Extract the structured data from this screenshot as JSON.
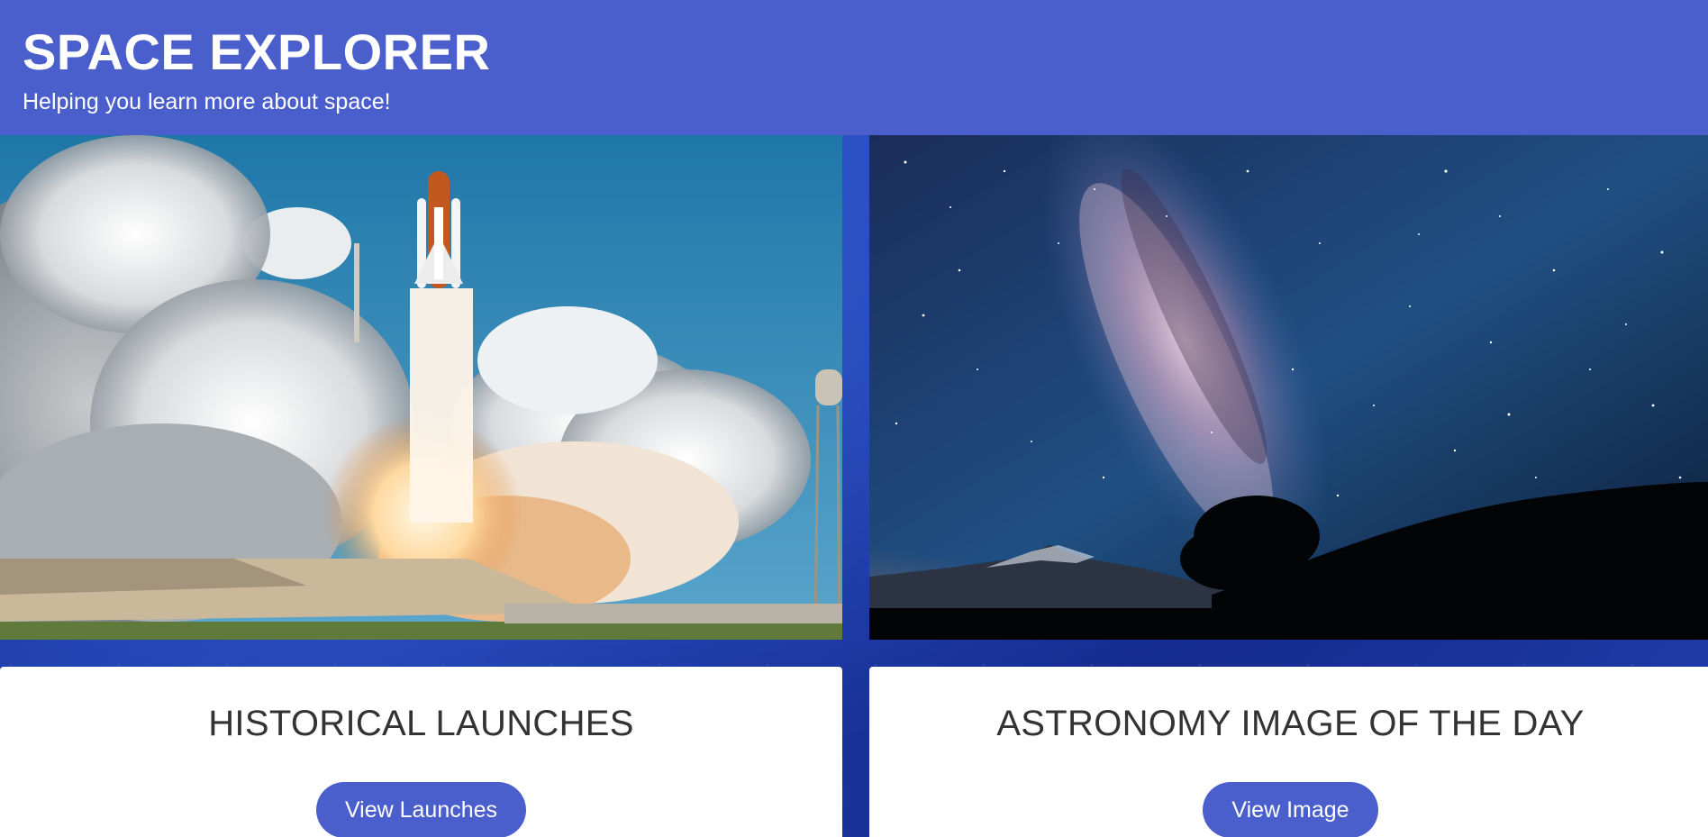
{
  "header": {
    "title": "SPACE EXPLORER",
    "subtitle": "Helping you learn more about space!"
  },
  "cards": [
    {
      "title": "HISTORICAL LAUNCHES",
      "button_label": "View Launches",
      "image_icon": "shuttle-launch-image"
    },
    {
      "title": "ASTRONOMY IMAGE OF THE DAY",
      "button_label": "View Image",
      "image_icon": "milky-way-image"
    }
  ],
  "colors": {
    "header_bg": "#4a5fcc",
    "button_bg": "#4a5fcc",
    "card_bg": "#ffffff",
    "title_text": "#333333",
    "page_bg": "#1b3aa6"
  }
}
